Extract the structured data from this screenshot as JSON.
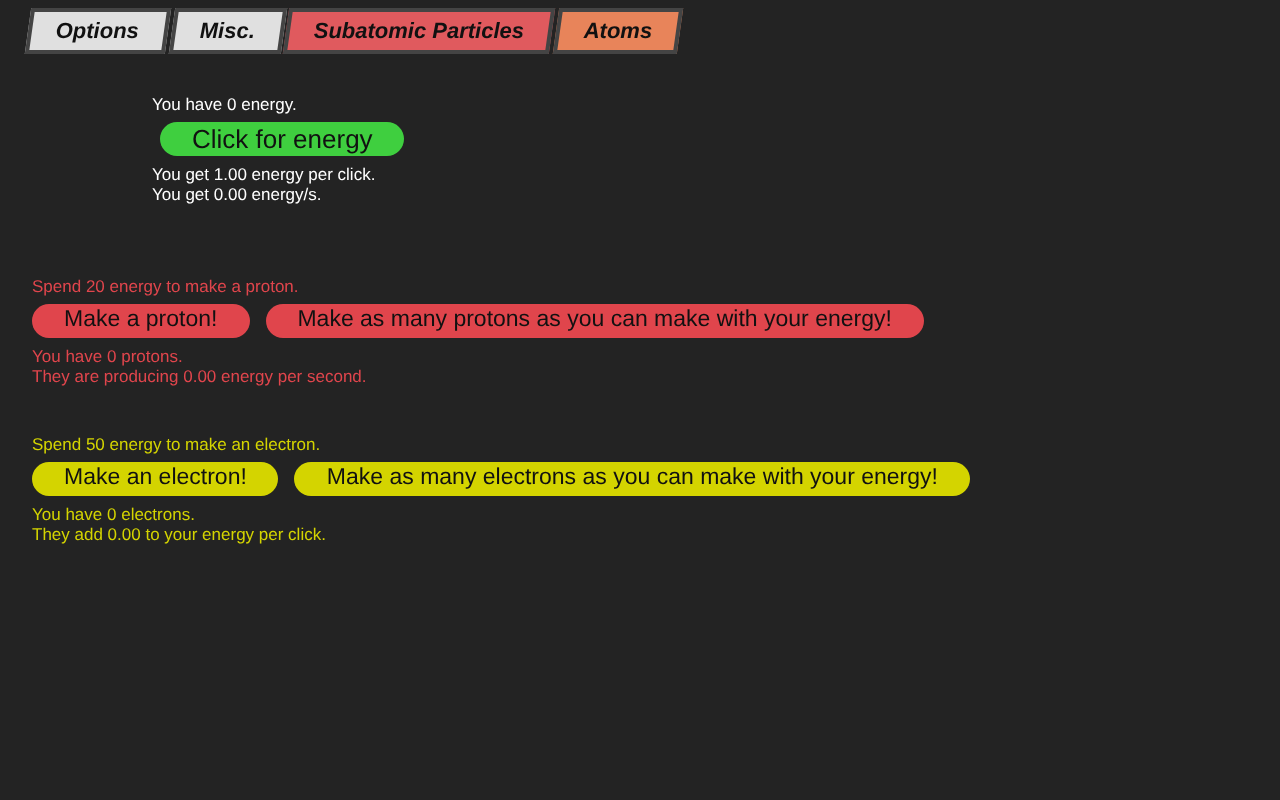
{
  "tabs": [
    {
      "label": "Options",
      "color": "#e0e0e0"
    },
    {
      "label": "Misc.",
      "color": "#e0e0e0"
    },
    {
      "label": "Subatomic Particles",
      "color": "#e05a5e"
    },
    {
      "label": "Atoms",
      "color": "#e8845a"
    }
  ],
  "energy": {
    "have": "You have 0 energy.",
    "button": "Click for energy",
    "per_click": "You get 1.00 energy per click.",
    "per_second": "You get 0.00 energy/s."
  },
  "particles": [
    {
      "color": "#e0454c",
      "cost": "Spend 20 energy to make a proton.",
      "make_button": "Make a proton!",
      "max_button": "Make as many protons as you can make with your energy!",
      "have": "You have 0 protons.",
      "effect": "They are producing 0.00 energy per second."
    },
    {
      "color": "#d4d400",
      "cost": "Spend 50 energy to make an electron.",
      "make_button": "Make an electron!",
      "max_button": "Make as many electrons as you can make with your energy!",
      "have": "You have 0 electrons.",
      "effect": "They add 0.00 to your energy per click."
    }
  ]
}
